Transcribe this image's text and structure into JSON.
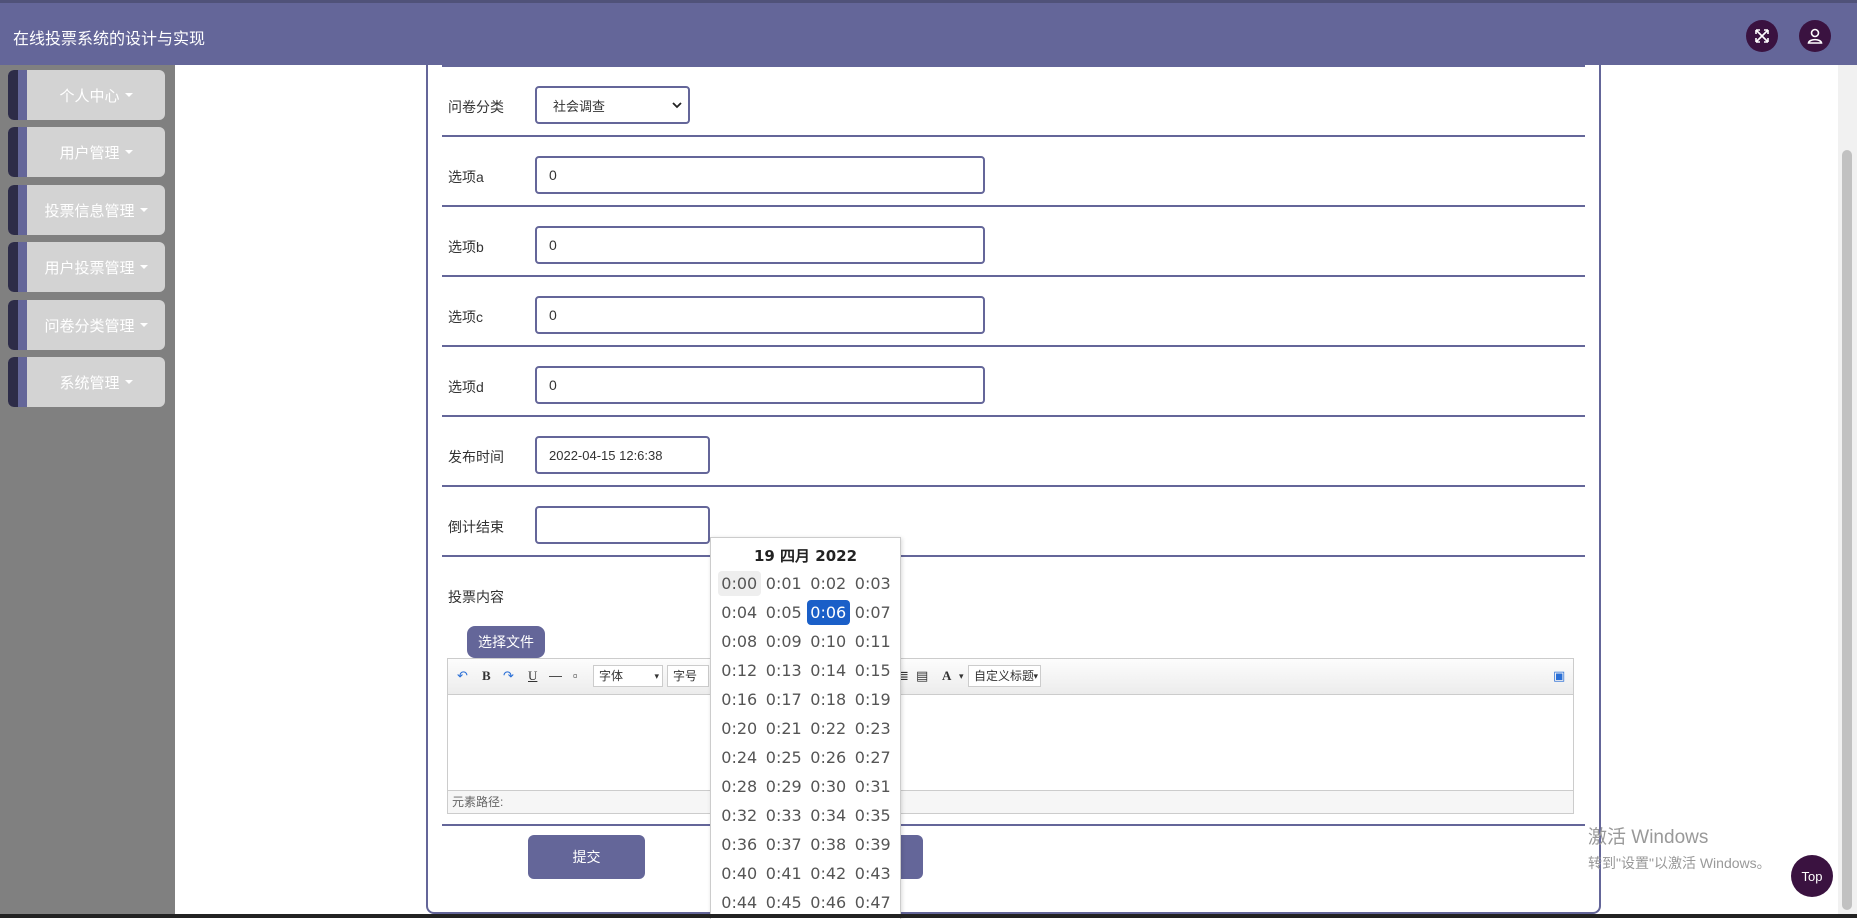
{
  "header": {
    "title": "在线投票系统的设计与实现",
    "accent_color": "#646699",
    "fullscreen_icon": "expand-icon",
    "user_icon": "user-icon"
  },
  "sidebar": {
    "items": [
      {
        "label": "个人中心"
      },
      {
        "label": "用户管理"
      },
      {
        "label": "投票信息管理"
      },
      {
        "label": "用户投票管理"
      },
      {
        "label": "问卷分类管理"
      },
      {
        "label": "系统管理"
      }
    ]
  },
  "form": {
    "category": {
      "label": "问卷分类",
      "value": "社会调查"
    },
    "option_a": {
      "label": "选项a",
      "value": "0"
    },
    "option_b": {
      "label": "选项b",
      "value": "0"
    },
    "option_c": {
      "label": "选项c",
      "value": "0"
    },
    "option_d": {
      "label": "选项d",
      "value": "0"
    },
    "publish_time": {
      "label": "发布时间",
      "value": "2022-04-15 12:6:38"
    },
    "countdown_end": {
      "label": "倒计结束",
      "value": ""
    },
    "content": {
      "label": "投票内容"
    },
    "choose_file": "选择文件",
    "submit": "提交"
  },
  "editor": {
    "font_family": "字体",
    "font_size": "字号",
    "custom_heading": "自定义标题",
    "font_color_label": "A",
    "bold_label": "B",
    "underline_label": "U",
    "element_path": "元素路径:"
  },
  "datetime_picker": {
    "title": "19 四月 2022",
    "selected": "0:06",
    "hovered": "0:00",
    "times": [
      "0:00",
      "0:01",
      "0:02",
      "0:03",
      "0:04",
      "0:05",
      "0:06",
      "0:07",
      "0:08",
      "0:09",
      "0:10",
      "0:11",
      "0:12",
      "0:13",
      "0:14",
      "0:15",
      "0:16",
      "0:17",
      "0:18",
      "0:19",
      "0:20",
      "0:21",
      "0:22",
      "0:23",
      "0:24",
      "0:25",
      "0:26",
      "0:27",
      "0:28",
      "0:29",
      "0:30",
      "0:31",
      "0:32",
      "0:33",
      "0:34",
      "0:35",
      "0:36",
      "0:37",
      "0:38",
      "0:39",
      "0:40",
      "0:41",
      "0:42",
      "0:43",
      "0:44",
      "0:45",
      "0:46",
      "0:47"
    ]
  },
  "watermark": {
    "line1": "激活 Windows",
    "line2": "转到\"设置\"以激活 Windows。"
  },
  "back_to_top": "Top"
}
